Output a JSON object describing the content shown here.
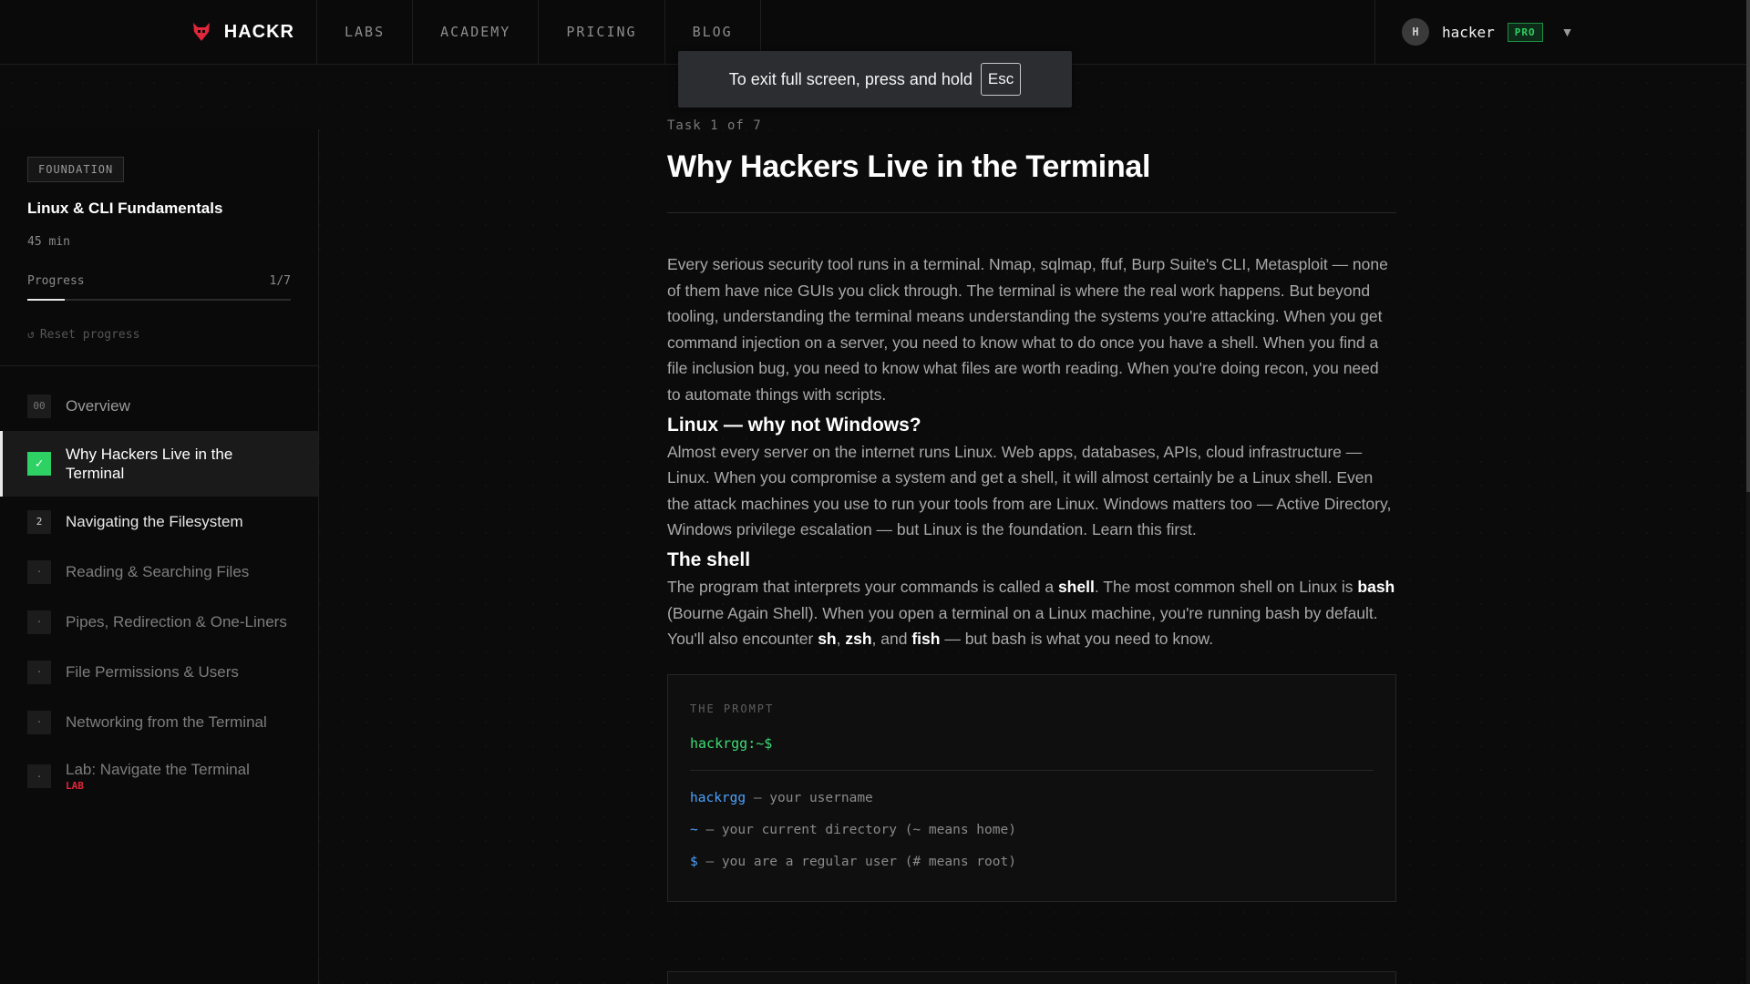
{
  "nav": {
    "brand": "HACKR",
    "links": [
      "LABS",
      "ACADEMY",
      "PRICING",
      "BLOG"
    ],
    "user": {
      "avatar_initial": "H",
      "name": "hacker",
      "badge": "PRO",
      "caret": "▼"
    }
  },
  "fullscreen_toast": {
    "text": "To exit full screen, press and hold",
    "key": "Esc"
  },
  "sidebar": {
    "tag": "FOUNDATION",
    "course_title": "Linux & CLI Fundamentals",
    "duration": "45 min",
    "progress_label": "Progress",
    "progress_text": "1/7",
    "progress_fraction": 0.143,
    "reset_icon": "↺",
    "reset_label": "Reset progress",
    "items": [
      {
        "num": "00",
        "label": "Overview",
        "state": "overview"
      },
      {
        "num": "✓",
        "label": "Why Hackers Live in the Terminal",
        "state": "active"
      },
      {
        "num": "2",
        "label": "Navigating the Filesystem",
        "state": "next"
      },
      {
        "num": "·",
        "label": "Reading & Searching Files",
        "state": "locked"
      },
      {
        "num": "·",
        "label": "Pipes, Redirection & One-Liners",
        "state": "locked"
      },
      {
        "num": "·",
        "label": "File Permissions & Users",
        "state": "locked"
      },
      {
        "num": "·",
        "label": "Networking from the Terminal",
        "state": "locked"
      },
      {
        "num": "·",
        "label": "Lab: Navigate the Terminal",
        "state": "locked",
        "tag": "LAB"
      }
    ]
  },
  "main": {
    "task_counter": "Task 1 of 7",
    "title": "Why Hackers Live in the Terminal",
    "intro": "Every serious security tool runs in a terminal. Nmap, sqlmap, ffuf, Burp Suite's CLI, Metasploit — none of them have nice GUIs you click through. The terminal is where the real work happens. But beyond tooling, understanding the terminal means understanding the systems you're attacking. When you get command injection on a server, you need to know what to do once you have a shell. When you find a file inclusion bug, you need to know what files are worth reading. When you're doing recon, you need to automate things with scripts.",
    "section1_heading": "Linux — why not Windows?",
    "section1_body": "Almost every server on the internet runs Linux. Web apps, databases, APIs, cloud infrastructure — Linux. When you compromise a system and get a shell, it will almost certainly be a Linux shell. Even the attack machines you use to run your tools from are Linux. Windows matters too — Active Directory, Windows privilege escalation — but Linux is the foundation. Learn this first.",
    "section2_heading": "The shell",
    "section2_p1": "The program that interprets your commands is called a ",
    "section2_b1": "shell",
    "section2_p2": ". The most common shell on Linux is ",
    "section2_b2": "bash",
    "section2_p3": " (Bourne Again Shell). When you open a terminal on a Linux machine, you're running bash by default. You'll also encounter ",
    "section2_b3": "sh",
    "section2_p4": ", ",
    "section2_b4": "zsh",
    "section2_p5": ", and ",
    "section2_b5": "fish",
    "section2_p6": " — but bash is what you need to know.",
    "code_card": {
      "label": "THE PROMPT",
      "prompt": "hackrgg:~$",
      "lines": [
        {
          "key": "hackrgg",
          "desc": " — your username"
        },
        {
          "key": "~",
          "desc": " — your current directory (~ means home)"
        },
        {
          "key": "$",
          "desc": " — you are a regular user (# means root)"
        }
      ]
    }
  },
  "colors": {
    "accent_green": "#2ed164",
    "lab_red": "#e0263a",
    "code_blue": "#4aa3ff"
  }
}
